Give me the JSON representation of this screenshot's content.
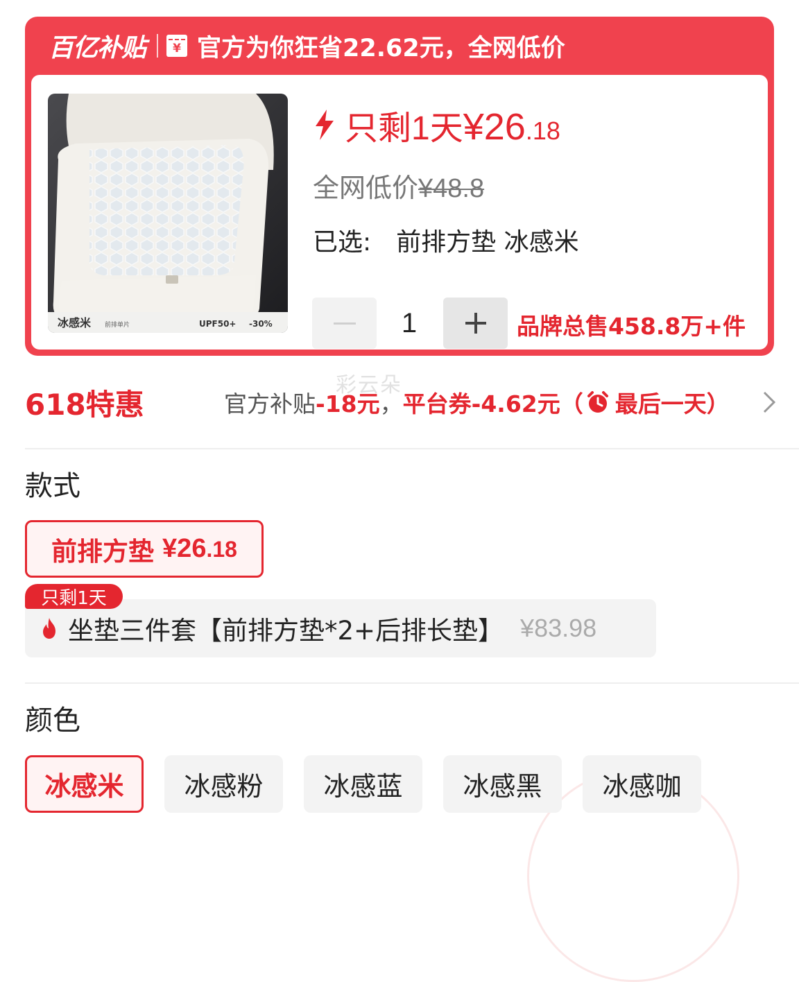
{
  "banner": {
    "brand": "百亿补贴",
    "ticket_symbol": "¥",
    "text": "官方为你狂省22.62元，全网低价"
  },
  "product": {
    "image_caption": "冰感米",
    "image_subcaption": "前排单片",
    "image_badge_upf": "UPF50+",
    "image_badge_temp": "-30%",
    "remaining": "只剩1天",
    "price_main": "¥26",
    "price_decimal": ".18",
    "compare_label": "全网低价",
    "compare_price": "¥48.8",
    "selected_label": "已选:",
    "selected_value": "前排方垫 冰感米",
    "quantity": "1",
    "brand_sales": "品牌总售458.8万+件"
  },
  "promo": {
    "title": "618特惠",
    "official_label": "官方补贴",
    "official_value": "-18元",
    "separator": "，",
    "platform_label": "平台券-4.62元（",
    "last_day": "最后一天）"
  },
  "watermark": "彩云朵",
  "style": {
    "title": "款式",
    "option1_name": "前排方垫",
    "option1_price_main": "¥26",
    "option1_price_decimal": ".18",
    "option2_badge": "只剩1天",
    "option2_name": "坐垫三件套【前排方垫*2+后排长垫】",
    "option2_price": "¥83.98"
  },
  "color": {
    "title": "颜色",
    "options": [
      "冰感米",
      "冰感粉",
      "冰感蓝",
      "冰感黑",
      "冰感咖"
    ],
    "selected_index": 0
  },
  "colors": {
    "accent": "#e4262f",
    "banner": "#f0424e",
    "chip_bg": "#f3f3f3"
  },
  "icons": [
    "ticket-icon",
    "flash-icon",
    "alarm-icon",
    "chevron-right-icon",
    "fire-icon",
    "minus-icon",
    "plus-icon"
  ]
}
